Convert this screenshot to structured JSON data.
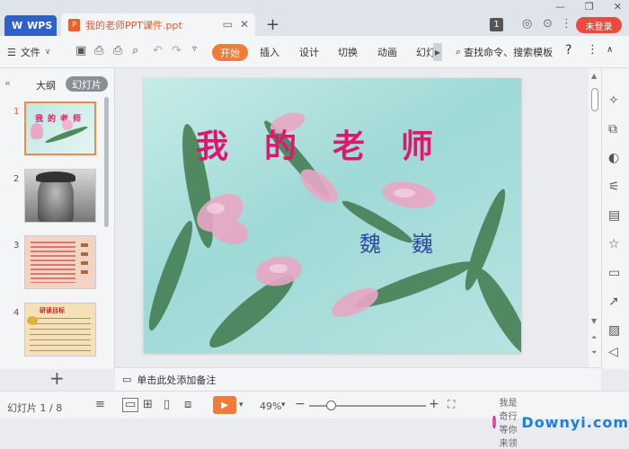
{
  "titlebar": {
    "wps_tab_label": "WPS",
    "doc_tab_label": "我的老师PPT课件.ppt",
    "add_tab_label": "+",
    "badge_number": "1",
    "login_label": "未登录"
  },
  "ribbon": {
    "file_menu_label": "文件",
    "tabs": [
      "开始",
      "插入",
      "设计",
      "切换",
      "动画",
      "幻灯"
    ],
    "search_label": "查找命令、搜索模板",
    "help_label": "?"
  },
  "left_panel": {
    "outline_tab": "大纲",
    "slides_tab": "幻灯片",
    "thumbnails": [
      {
        "number": "1"
      },
      {
        "number": "2"
      },
      {
        "number": "3"
      },
      {
        "number": "4",
        "caption": "研读目标"
      }
    ],
    "thumb1_text": "我的老师",
    "add_slide_label": "+"
  },
  "slide": {
    "title": "我的老师",
    "author": "魏巍"
  },
  "notes": {
    "placeholder": "单击此处添加备注"
  },
  "statusbar": {
    "slide_indicator": "幻灯片 1 / 8",
    "zoom_percent": "49%",
    "zoom_level": 0.49
  },
  "watermark": {
    "caption": "我是奇行 等你来领",
    "logo_text": "Downyi.com"
  },
  "colors": {
    "accent": "#f07c3a",
    "wps_blue": "#2e62c9",
    "login_red": "#e84a3e",
    "title_magenta": "#e0166e",
    "author_blue": "#2b4aa0"
  }
}
